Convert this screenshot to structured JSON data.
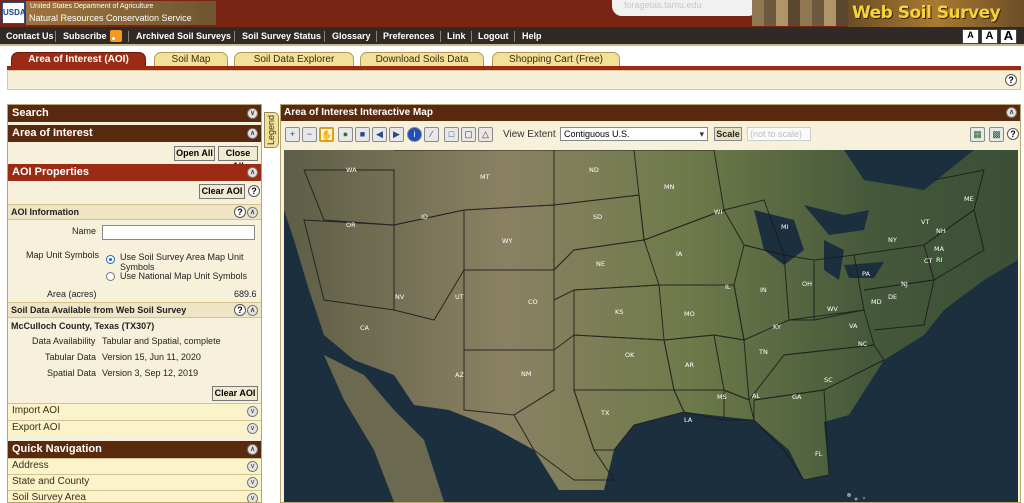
{
  "header": {
    "usda_logo": "USDA",
    "agency_line1": "United States Department of Agriculture",
    "agency_line2": "Natural Resources Conservation Service",
    "search_hint": "foragetas.tamu.edu",
    "app_logo": "Web Soil Survey"
  },
  "topnav": {
    "items": [
      "Contact Us",
      "Subscribe",
      "Archived Soil Surveys",
      "Soil Survey Status",
      "Glossary",
      "Preferences",
      "Link",
      "Logout",
      "Help"
    ],
    "text_sizes": [
      "A",
      "A",
      "A"
    ]
  },
  "tabs": [
    {
      "label": "Area of Interest (AOI)",
      "active": true
    },
    {
      "label": "Soil Map",
      "active": false
    },
    {
      "label": "Soil Data Explorer",
      "active": false
    },
    {
      "label": "Download Soils Data",
      "active": false
    },
    {
      "label": "Shopping Cart (Free)",
      "active": false
    }
  ],
  "left": {
    "search": "Search",
    "area_of_interest": "Area of Interest",
    "open_all": "Open All",
    "close_all": "Close All",
    "aoi_properties": "AOI Properties",
    "clear_aoi": "Clear AOI",
    "aoi_information": "AOI Information",
    "name_label": "Name",
    "name_value": "",
    "map_unit_symbols_label": "Map Unit Symbols",
    "radio1": "Use Soil Survey Area Map Unit Symbols",
    "radio2": "Use National Map Unit Symbols",
    "area_label": "Area (acres)",
    "area_value": "689.6",
    "soil_data_available": "Soil Data Available from Web Soil Survey",
    "county": "McCulloch County, Texas (TX307)",
    "data_availability_label": "Data Availability",
    "data_availability_value": "Tabular and Spatial, complete",
    "tabular_data_label": "Tabular Data",
    "tabular_data_value": "Version 15, Jun 11, 2020",
    "spatial_data_label": "Spatial Data",
    "spatial_data_value": "Version 3, Sep 12, 2019",
    "clear_aoi_bottom": "Clear AOI",
    "import_aoi": "Import AOI",
    "export_aoi": "Export AOI",
    "quick_navigation": "Quick Navigation",
    "address": "Address",
    "state_and_county": "State and County",
    "soil_survey_area": "Soil Survey Area"
  },
  "legend_tab": "Legend",
  "map": {
    "title": "Area of Interest Interactive Map",
    "view_extent_label": "View Extent",
    "view_extent_value": "Contiguous U.S.",
    "scale_label": "Scale",
    "scale_value": "(not to scale)",
    "states": [
      "WA",
      "MT",
      "ND",
      "MN",
      "OR",
      "ID",
      "SD",
      "WI",
      "ME",
      "VT",
      "NH",
      "NY",
      "MA",
      "MI",
      "WY",
      "CT",
      "RI",
      "IA",
      "NE",
      "PA",
      "NJ",
      "NV",
      "UT",
      "IL",
      "IN",
      "OH",
      "DE",
      "MD",
      "CO",
      "WV",
      "CA",
      "KS",
      "MO",
      "VA",
      "KY",
      "NC",
      "TN",
      "OK",
      "AR",
      "SC",
      "AZ",
      "NM",
      "MS",
      "AL",
      "GA",
      "TX",
      "LA",
      "FL"
    ]
  },
  "colors": {
    "banner": "#7a2414",
    "tab_active": "#9b2b12",
    "tab_inactive": "#f2e198",
    "section_head": "#5a2a0e",
    "panel_bg": "#f7f0da",
    "accent_radio": "#1e63c6"
  }
}
